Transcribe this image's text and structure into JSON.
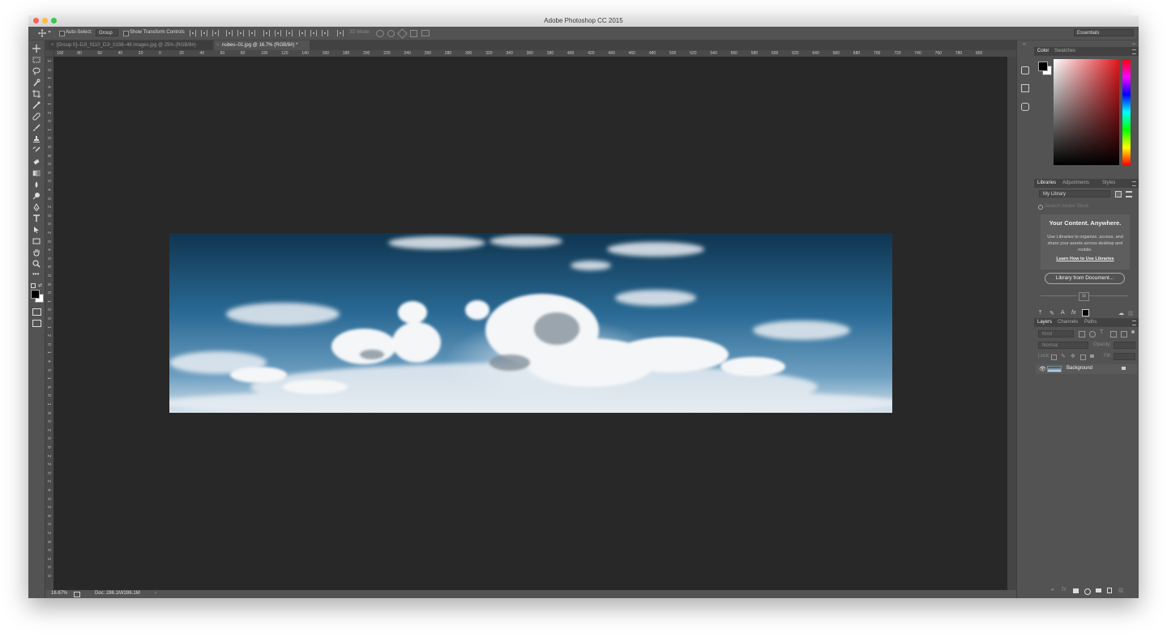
{
  "app": {
    "title": "Adobe Photoshop CC 2015"
  },
  "options_bar": {
    "auto_select_label": "Auto-Select:",
    "auto_select_value": "Group",
    "show_transform_label": "Show Transform Controls",
    "mode_3d_label": "3D Mode:",
    "workspace": "Essentials"
  },
  "tabs": [
    {
      "label": "[Group 0]–DJI_0110_DJI_0158–49 images.jpg @ 25% (RGB/8#)"
    },
    {
      "label": "nubes–01.jpg @ 16.7% (RGB/8#) *"
    }
  ],
  "rulers": {
    "top": [
      "100",
      "80",
      "60",
      "40",
      "20",
      "0",
      "20",
      "40",
      "60",
      "80",
      "100",
      "120",
      "140",
      "160",
      "180",
      "200",
      "220",
      "240",
      "260",
      "280",
      "300",
      "320",
      "340",
      "360",
      "380",
      "400",
      "420",
      "440",
      "460",
      "480",
      "500",
      "520",
      "540",
      "560",
      "580",
      "600",
      "620",
      "640",
      "660",
      "680",
      "700",
      "720",
      "740",
      "760",
      "780",
      "800"
    ],
    "left": [
      "1",
      "0",
      "1",
      "4",
      "0",
      "1",
      "2",
      "0",
      "1",
      "0",
      "0",
      "8",
      "0",
      "6",
      "0",
      "4",
      "0",
      "2",
      "0",
      "0",
      "2",
      "0",
      "4",
      "0",
      "6",
      "0",
      "8",
      "0",
      "1",
      "0",
      "0",
      "1",
      "2",
      "0",
      "1",
      "4",
      "0",
      "1",
      "6",
      "0",
      "1",
      "8",
      "0",
      "2",
      "0",
      "0",
      "2",
      "2",
      "0",
      "2",
      "4",
      "0",
      "2",
      "6",
      "0",
      "2",
      "8",
      "0",
      "3",
      "0",
      "0"
    ]
  },
  "status": {
    "zoom": "16.67%",
    "doc": "Doc: 286.1M/286.1M"
  },
  "color_panel": {
    "tabs": [
      "Color",
      "Swatches"
    ]
  },
  "libraries_panel": {
    "tabs": [
      "Libraries",
      "Adjustments",
      "Styles"
    ],
    "library_select": "My Library",
    "search_placeholder": "Search Adobe Stock",
    "headline": "Your Content. Anywhere.",
    "body": "Use Libraries to organize, access, and share your assets across desktop and mobile.",
    "link": "Learn How to Use Libraries",
    "button": "Library from Document...",
    "badge": "St"
  },
  "layers_panel": {
    "tabs": [
      "Layers",
      "Channels",
      "Paths"
    ],
    "kind_label": "Kind",
    "blend_mode": "Normal",
    "opacity_label": "Opacity:",
    "lock_label": "Lock:",
    "fill_label": "Fill:",
    "layer_name": "Background"
  },
  "colors": {
    "canvas_bg": "#282828",
    "panel_bg": "#535353",
    "ruler_bg": "#4a4a4a"
  }
}
